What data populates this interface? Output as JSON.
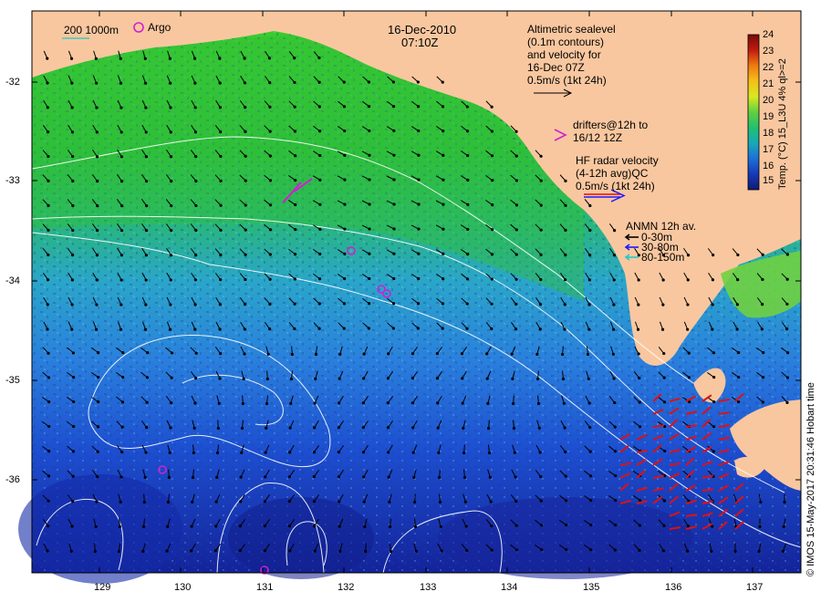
{
  "title": {
    "date": "16-Dec-2010",
    "time": "07:10Z"
  },
  "scale_legend": {
    "depth_labels": "200  1000m",
    "argo_label": "Argo"
  },
  "altimetry_note": {
    "lines": [
      "Altimetric sealevel",
      "(0.1m contours)",
      "and velocity for",
      "16-Dec 07Z",
      "0.5m/s (1kt 24h)"
    ]
  },
  "drifter_note": {
    "symbol": ">",
    "lines": [
      "drifters@12h to",
      "16/12 12Z"
    ]
  },
  "hf_radar_note": {
    "lines": [
      "HF radar velocity",
      "(4-12h avg)QC",
      "0.5m/s (1kt 24h)"
    ]
  },
  "anmn_legend": {
    "title": "ANMN 12h av.",
    "items": [
      {
        "label": "0-30m",
        "color": "#000000"
      },
      {
        "label": "30-80m",
        "color": "#1a1aff"
      },
      {
        "label": "80-150m",
        "color": "#20c8c8"
      }
    ]
  },
  "colorbar": {
    "title": "Temp. (°C) 15_L3U 4% ql>=2",
    "ticks": [
      "24",
      "23",
      "22",
      "21",
      "20",
      "19",
      "18",
      "17",
      "16",
      "15"
    ],
    "colors": [
      "#7a0a0a",
      "#b01818",
      "#e03a10",
      "#f07a10",
      "#f4b818",
      "#f0e020",
      "#b8e020",
      "#58d040",
      "#20c060",
      "#18b0a0",
      "#1880d0",
      "#1a50d8",
      "#1430b0",
      "#101c80"
    ]
  },
  "axes": {
    "x_ticks": [
      "129",
      "130",
      "131",
      "132",
      "133",
      "134",
      "135",
      "136",
      "137"
    ],
    "y_ticks": [
      "-32",
      "-33",
      "-34",
      "-35",
      "-36"
    ],
    "lon_range": [
      128.2,
      137.55
    ],
    "lat_range": [
      -36.95,
      -31.3
    ]
  },
  "credit": "© IMOS 15-May-2017 20:31:46 Hobart time",
  "colors": {
    "land": "#f9c79f",
    "sea_warm": "#2fbf3a",
    "sea_mid": "#2a9fd8",
    "sea_cool": "#1d4fd0",
    "sea_cold": "#1426a0",
    "contour": "#ffffff",
    "argo": "#d020d0",
    "hf_radar": "#e01010"
  }
}
